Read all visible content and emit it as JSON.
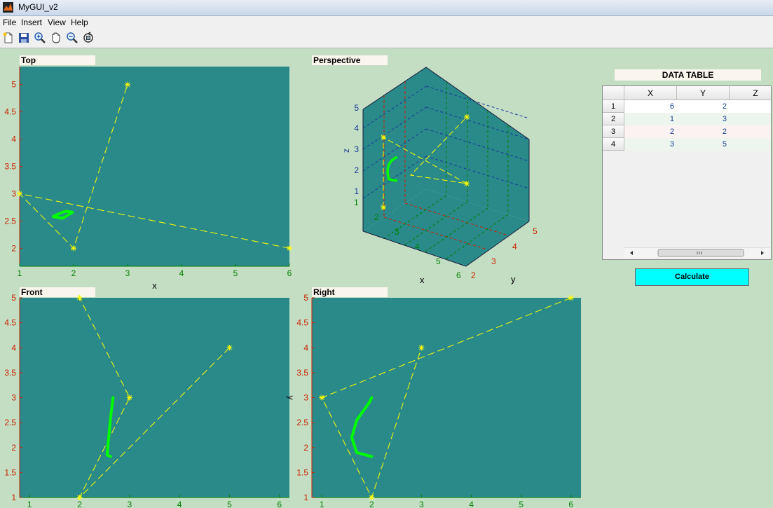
{
  "window": {
    "title": "MyGUI_v2"
  },
  "menu": [
    "File",
    "Insert",
    "View",
    "Help"
  ],
  "toolbar": [
    {
      "icon": "new-file-icon"
    },
    {
      "icon": "save-icon"
    },
    {
      "icon": "zoom-in-icon"
    },
    {
      "icon": "pan-hand-icon"
    },
    {
      "icon": "zoom-out-icon"
    },
    {
      "icon": "rotate-3d-icon"
    }
  ],
  "colors": {
    "axes_bg": "#2a8a8a",
    "figure_bg": "#c4dec4",
    "line": "#ffff00",
    "curve": "#00ff00",
    "tick_x": "#008000",
    "tick_y": "#cc2200",
    "tick_z": "#1a3a99"
  },
  "panels": {
    "top": {
      "title": "Top"
    },
    "perspective": {
      "title": "Perspective"
    },
    "front": {
      "title": "Front"
    },
    "right": {
      "title": "Right"
    }
  },
  "chart_data": [
    {
      "id": "top",
      "type": "line",
      "title": "Top",
      "xlabel": "x",
      "ylabel": "",
      "xlim": [
        1,
        6
      ],
      "ylim": [
        1.67,
        5.33
      ],
      "xticks": [
        "1",
        "2",
        "3",
        "4",
        "5",
        "6"
      ],
      "yticks": [
        "2",
        "2.5",
        "3",
        "3.5",
        "4",
        "4.5",
        "5"
      ],
      "series": [
        {
          "points": [
            [
              6,
              2
            ],
            [
              1,
              3
            ],
            [
              2,
              2
            ],
            [
              3,
              5
            ]
          ]
        }
      ],
      "curve": [
        [
          1.65,
          2.6
        ],
        [
          1.85,
          2.68
        ],
        [
          1.98,
          2.66
        ],
        [
          1.8,
          2.55
        ],
        [
          1.62,
          2.58
        ],
        [
          1.65,
          2.6
        ]
      ]
    },
    {
      "id": "perspective",
      "type": "scatter",
      "title": "Perspective",
      "xlabel": "x",
      "ylabel": "y",
      "zlabel": "z",
      "x_ticks": [
        "1",
        "2",
        "3",
        "4",
        "5",
        "6"
      ],
      "y_ticks": [
        "2",
        "3",
        "4",
        "5"
      ],
      "z_ticks": [
        "1",
        "2",
        "3",
        "4",
        "5"
      ]
    },
    {
      "id": "front",
      "type": "line",
      "title": "Front",
      "xlabel": "",
      "ylabel": "",
      "xlim": [
        0.8,
        6.2
      ],
      "ylim": [
        1,
        5
      ],
      "xticks": [
        "1",
        "2",
        "3",
        "4",
        "5",
        "6"
      ],
      "yticks": [
        "1",
        "1.5",
        "2",
        "2.5",
        "3",
        "3.5",
        "4",
        "4.5",
        "5"
      ],
      "series": [
        {
          "points": [
            [
              5,
              4
            ],
            [
              2,
              1
            ],
            [
              3,
              3
            ],
            [
              2,
              5
            ]
          ]
        }
      ],
      "curve": [
        [
          2.62,
          1.82
        ],
        [
          2.55,
          1.85
        ],
        [
          2.62,
          2.6
        ],
        [
          2.67,
          3.0
        ]
      ]
    },
    {
      "id": "right",
      "type": "line",
      "title": "Right",
      "xlabel": "",
      "ylabel": "y",
      "xlim": [
        0.8,
        6.2
      ],
      "ylim": [
        1,
        5
      ],
      "xticks": [
        "1",
        "2",
        "3",
        "4",
        "5",
        "6"
      ],
      "yticks": [
        "1",
        "1.5",
        "2",
        "2.5",
        "3",
        "3.5",
        "4",
        "4.5",
        "5"
      ],
      "series": [
        {
          "points": [
            [
              6,
              5
            ],
            [
              1,
              3
            ],
            [
              2,
              1
            ],
            [
              3,
              4
            ]
          ]
        }
      ],
      "curve": [
        [
          2.0,
          1.82
        ],
        [
          1.7,
          1.9
        ],
        [
          1.6,
          2.2
        ],
        [
          1.7,
          2.55
        ],
        [
          1.95,
          2.9
        ],
        [
          2.0,
          3.0
        ]
      ]
    }
  ],
  "data_table": {
    "title": "DATA TABLE",
    "columns": [
      "X",
      "Y",
      "Z"
    ],
    "row_labels": [
      "1",
      "2",
      "3",
      "4"
    ],
    "rows": [
      [
        "6",
        "2",
        ""
      ],
      [
        "1",
        "3",
        ""
      ],
      [
        "2",
        "2",
        ""
      ],
      [
        "3",
        "5",
        ""
      ]
    ]
  },
  "buttons": {
    "calculate": "Calculate"
  }
}
